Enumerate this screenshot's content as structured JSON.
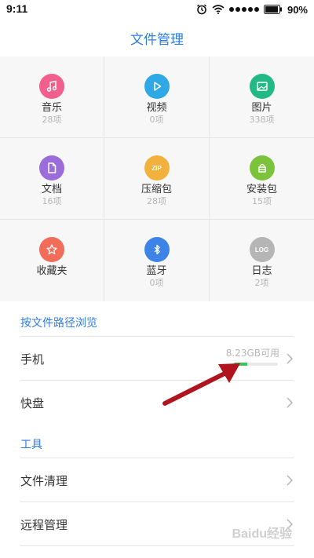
{
  "status_bar": {
    "time": "9:11",
    "battery": "90%"
  },
  "header": {
    "title": "文件管理"
  },
  "categories": [
    {
      "label": "音乐",
      "count": "28项",
      "icon": "music-note-icon",
      "color": "#f25e8e"
    },
    {
      "label": "视频",
      "count": "0项",
      "icon": "play-icon",
      "color": "#2fa8e6"
    },
    {
      "label": "图片",
      "count": "338项",
      "icon": "image-icon",
      "color": "#22b987"
    },
    {
      "label": "文档",
      "count": "16项",
      "icon": "document-icon",
      "color": "#9a6ddb"
    },
    {
      "label": "压缩包",
      "count": "28项",
      "icon": "zip-icon",
      "color": "#f2b13c",
      "icon_text": "ZIP"
    },
    {
      "label": "安装包",
      "count": "15项",
      "icon": "package-icon",
      "color": "#7cc33c"
    },
    {
      "label": "收藏夹",
      "count": "",
      "icon": "star-icon",
      "color": "#f26c5a"
    },
    {
      "label": "蓝牙",
      "count": "0项",
      "icon": "bluetooth-icon",
      "color": "#3d84e6"
    },
    {
      "label": "日志",
      "count": "2项",
      "icon": "log-icon",
      "color": "#b5b5b5",
      "icon_text": "LOG"
    }
  ],
  "browse": {
    "header": "按文件路径浏览",
    "phone": {
      "label": "手机",
      "storage_text": "8.23GB可用",
      "storage_used_fraction": 0.3
    },
    "kuaipan": {
      "label": "快盘"
    }
  },
  "tools": {
    "header": "工具",
    "items": [
      {
        "label": "文件清理"
      },
      {
        "label": "远程管理"
      }
    ]
  },
  "colors": {
    "accent": "#2e7de0",
    "annotation_arrow": "#b0141e",
    "storage_fill": "#3cc35a"
  },
  "watermark": "Baidu经验"
}
